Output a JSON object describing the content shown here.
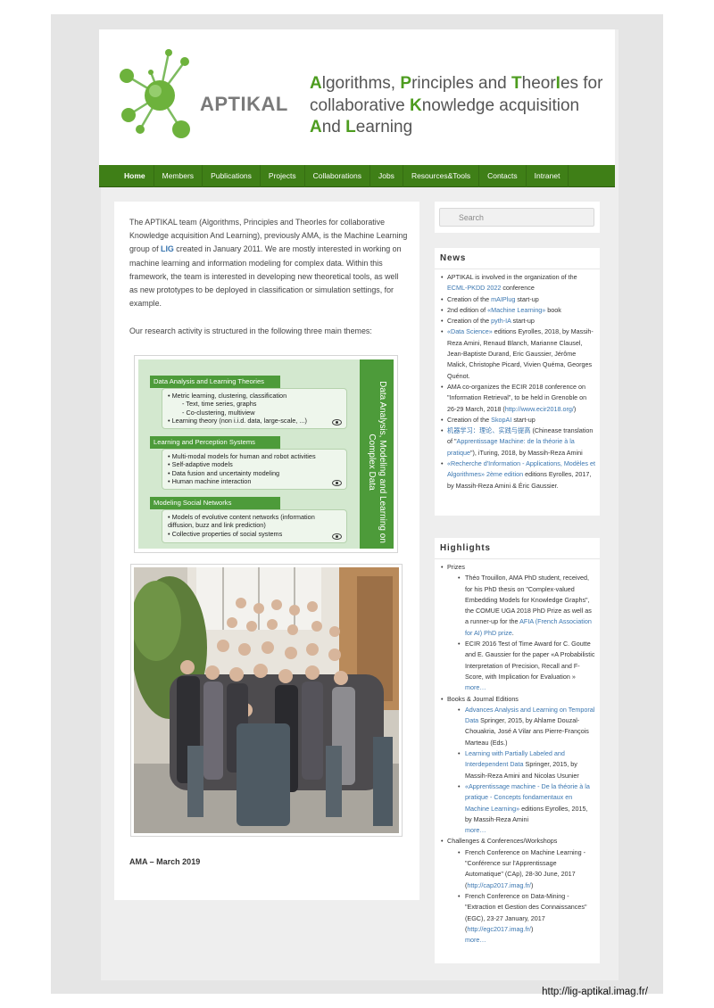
{
  "header": {
    "logo_text": "APTIKAL",
    "tagline": [
      [
        {
          "t": "A",
          "cap": true
        },
        {
          "t": "lgorithms, "
        },
        {
          "t": "P",
          "cap": true
        },
        {
          "t": "rinciples and "
        },
        {
          "t": "T",
          "cap": true
        },
        {
          "t": "heor"
        },
        {
          "t": "I",
          "cap": true
        },
        {
          "t": "es for"
        }
      ],
      [
        {
          "t": "collaborative "
        },
        {
          "t": "K",
          "cap": true
        },
        {
          "t": "nowledge acquisition"
        }
      ],
      [
        {
          "t": "A",
          "cap": true
        },
        {
          "t": "nd "
        },
        {
          "t": "L",
          "cap": true
        },
        {
          "t": "earning"
        }
      ]
    ],
    "colors": {
      "brand_green": "#4d9c1f",
      "nav_green": "#3f7f17"
    }
  },
  "nav": [
    {
      "label": "Home",
      "active": true
    },
    {
      "label": "Members"
    },
    {
      "label": "Publications"
    },
    {
      "label": "Projects"
    },
    {
      "label": "Collaborations"
    },
    {
      "label": "Jobs"
    },
    {
      "label": "Resources&Tools"
    },
    {
      "label": "Contacts"
    },
    {
      "label": "Intranet"
    }
  ],
  "main": {
    "intro": {
      "before": "The APTIKAL team (Algorithms, Principles and TheorIes for collaborative Knowledge acquisition And Learning), previously AMA, is the Machine Learning group of ",
      "link": "LIG",
      "after": " created in January 2011. We are mostly interested in  working on machine learning and information modeling for complex data. Within this framework, the team is interested in developing new theoretical tools, as well as new prototypes to be deployed in classification or simulation settings, for example."
    },
    "themes_intro": "Our research activity is structured in the following three main themes:",
    "themes_figure": {
      "side_title": "Data Analysis, Modeling and Learning on Complex Data",
      "themes": [
        {
          "title": "Data Analysis and Learning Theories",
          "items": [
            "• Metric learning, clustering, classification",
            "- Text, time series, graphs",
            "- Co-clustering, multiview",
            "• Learning theory (non i.i.d. data, large-scale, ...)"
          ]
        },
        {
          "title": "Learning and Perception Systems",
          "items": [
            "• Multi-modal models for human and robot activities",
            "• Self-adaptive models",
            "• Data fusion and uncertainty modeling",
            "• Human machine interaction"
          ]
        },
        {
          "title": "Modeling Social Networks",
          "items": [
            "• Models of evolutive content networks (information diffusion, buzz and link prediction)",
            "• Collective properties of social systems"
          ]
        }
      ]
    },
    "photo_caption": "AMA – March 2019"
  },
  "sidebar": {
    "search": {
      "placeholder": "Search"
    },
    "news": {
      "title": "News",
      "items": [
        [
          {
            "t": "APTIKAL is involved in the organization of the "
          },
          {
            "t": "ECML-PKDD 2022",
            "link": true
          },
          {
            "t": " conference"
          }
        ],
        [
          {
            "t": "Creation of the "
          },
          {
            "t": "mAIPlug",
            "link": true
          },
          {
            "t": " start-up"
          }
        ],
        [
          {
            "t": "2nd edition of "
          },
          {
            "t": "«Machine Learning»",
            "link": true
          },
          {
            "t": " book"
          }
        ],
        [
          {
            "t": "Creation of the "
          },
          {
            "t": "pyth-IA",
            "link": true
          },
          {
            "t": " start-up"
          }
        ],
        [
          {
            "t": "«Data Science»",
            "link": true
          },
          {
            "t": " editions Eyrolles, 2018, by Massih-Reza Amini, Renaud Blanch, Marianne Clausel, Jean-Baptiste Durand, Eric Gaussier, Jérôme Malick, Christophe Picard, Vivien Quéma, Georges Quénot."
          }
        ],
        [
          {
            "t": "AMA co-organizes the ECIR 2018 conference on \"Information Retrieval\", to be held in Grenoble on 26-29 March, 2018 ("
          },
          {
            "t": "http://www.ecir2018.org/",
            "link": true
          },
          {
            "t": ")"
          }
        ],
        [
          {
            "t": "Creation of the "
          },
          {
            "t": "SkopAI",
            "link": true
          },
          {
            "t": " start-up"
          }
        ],
        [
          {
            "t": "机器学习：理论、实践与提高",
            "link": true
          },
          {
            "t": " (Chinease translation of \""
          },
          {
            "t": "Apprentissage Machine: de la théorie à la pratique",
            "link": true
          },
          {
            "t": "\"), iTuring, 2018, by Massih-Reza Amini"
          }
        ],
        [
          {
            "t": "«Recherche d'Information - Applications, Modèles et Algorithmes» 2ème edition",
            "link": true
          },
          {
            "t": " editions Eyrolles, 2017, by Massih-Reza Amini & Éric Gaussier."
          }
        ]
      ]
    },
    "highlights": {
      "title": "Highlights",
      "groups": [
        {
          "label": "Prizes",
          "items": [
            [
              {
                "t": "Théo Trouillon, AMA PhD student, received, for his PhD thesis on \"Complex-valued Embedding Models for Knowledge Graphs\", the COMUE UGA 2018 PhD Prize as well as a runner-up for the "
              },
              {
                "t": "AFIA (French Association for AI) PhD prize",
                "link": true
              },
              {
                "t": "."
              }
            ],
            [
              {
                "t": "ECIR 2016 Test of Time Award for C. Goutte and E. Gaussier for the paper «A Probabilistic Interpretation of Precision, Recall and F-Score, with Implication for Evaluation »"
              }
            ]
          ],
          "more": "more…"
        },
        {
          "label": "Books & Journal Editions",
          "items": [
            [
              {
                "t": "Advances Analysis and Learning on Temporal Data",
                "link": true
              },
              {
                "t": " Springer, 2015, by Ahlame Douzal-Chouakria, José A Vilar ans Pierre-François Marteau (Eds.)"
              }
            ],
            [
              {
                "t": "Learning with Partially Labeled and Interdependent Data",
                "link": true
              },
              {
                "t": " Springer, 2015, by Massih-Reza Amini and Nicolas Usunier"
              }
            ],
            [
              {
                "t": "«Apprentissage machine - De la théorie à la pratique - Concepts fondamentaux en Machine Learning»",
                "link": true
              },
              {
                "t": " editions Eyrolles, 2015, by Massih-Reza Amini"
              }
            ]
          ],
          "more": "more…"
        },
        {
          "label": "Challenges & Conferences/Workshops",
          "items": [
            [
              {
                "t": "French Conference on Machine Learning - \"Conférence sur l'Apprentissage Automatique\" (CAp), 28-30 June, 2017 ("
              },
              {
                "t": "http://cap2017.imag.fr/",
                "link": true
              },
              {
                "t": ")"
              }
            ],
            [
              {
                "t": "French Conference on Data-Mining - \"Extraction et Gestion des Connaissances\" (EGC), 23-27 January, 2017 ("
              },
              {
                "t": "http://egc2017.imag.fr/",
                "link": true
              },
              {
                "t": ")"
              }
            ]
          ],
          "more": "more…"
        }
      ]
    }
  },
  "footer": {
    "url": "http://lig-aptikal.imag.fr/"
  }
}
